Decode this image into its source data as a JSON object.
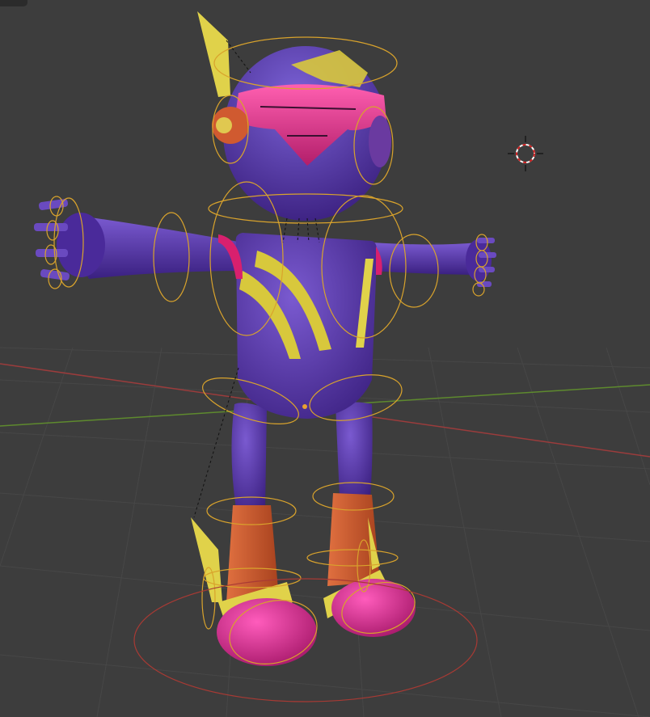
{
  "viewport": {
    "type": "3d-viewport",
    "background": "#3d3d3d",
    "grid_color": "#474747",
    "x_axis_color": "#9b3c3c",
    "y_axis_color": "#5e8a2e"
  },
  "scene": {
    "character": {
      "palette": {
        "body": "#4a2a9a",
        "body_light": "#7a5ad0",
        "visor": "#d0307a",
        "accent": "#e0d24a",
        "boots": "#cf5a2c",
        "shoes": "#d8208a"
      }
    },
    "armature_control_color": "#d9a32c",
    "root_control_color": "#a83a34",
    "icons": {
      "cursor": "3d-cursor-icon"
    }
  }
}
